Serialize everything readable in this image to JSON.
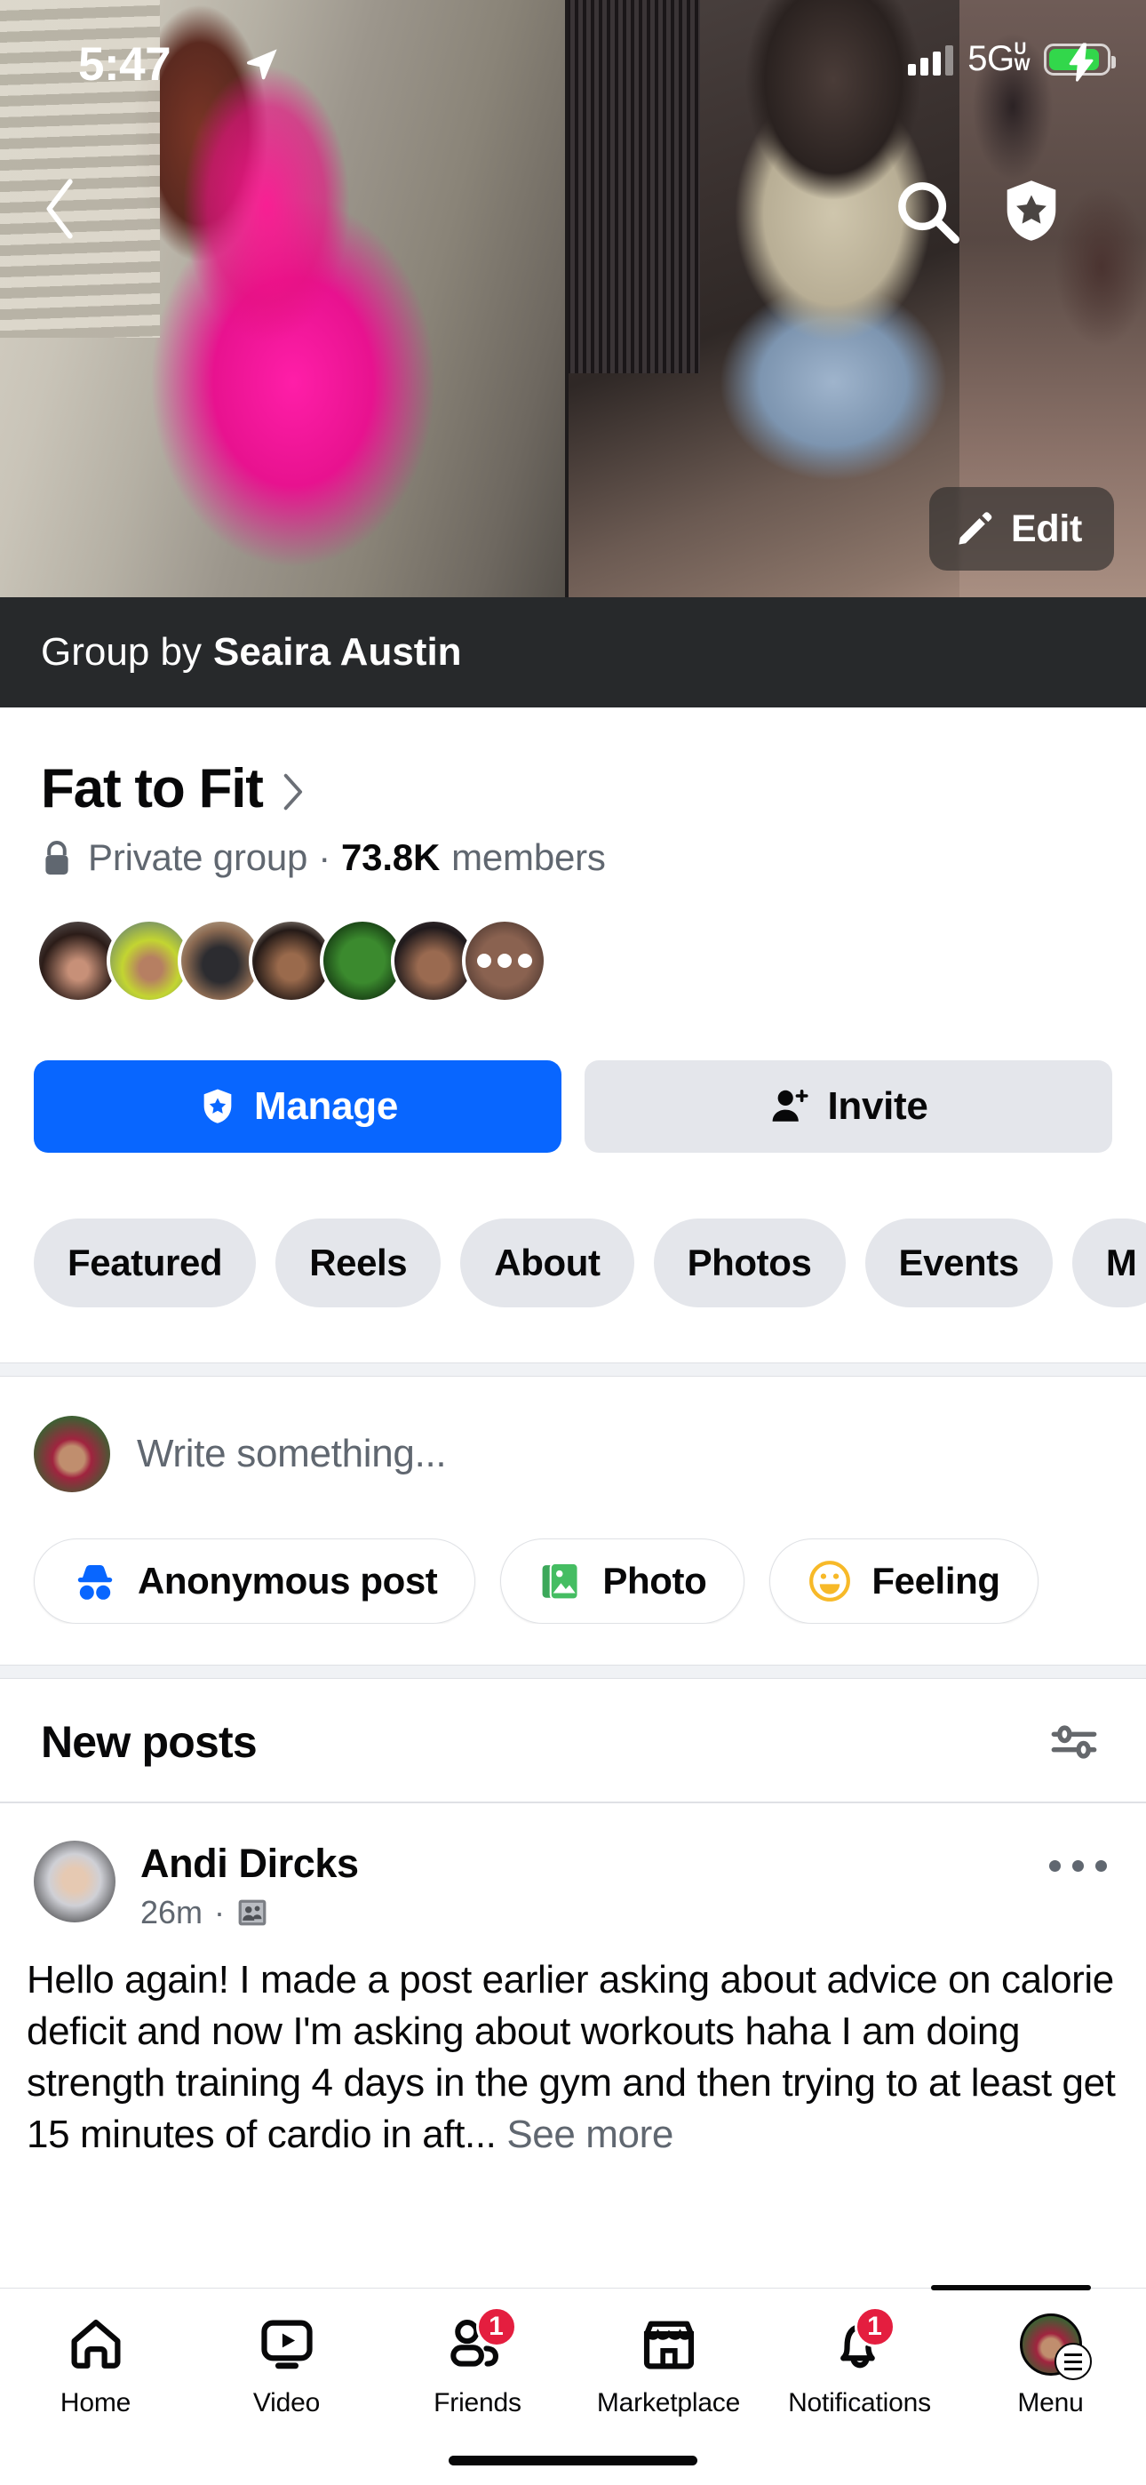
{
  "status_bar": {
    "time": "5:47",
    "location_icon": "location-arrow-icon",
    "signal_icon": "cellular-bars-icon",
    "network": "5G",
    "network_suffix_top": "U",
    "network_suffix_bottom": "W",
    "battery_icon": "battery-charging-icon",
    "battery_color": "#32d74b"
  },
  "cover": {
    "back_icon": "back-chevron-icon",
    "search_icon": "search-icon",
    "shield_icon": "shield-star-icon",
    "edit_label": "Edit",
    "edit_icon": "pencil-icon"
  },
  "group_by": {
    "prefix": "Group by",
    "owner": "Seaira Austin"
  },
  "group": {
    "name": "Fat to Fit",
    "chevron_icon": "chevron-right-icon",
    "lock_icon": "lock-icon",
    "privacy": "Private group",
    "separator": "·",
    "member_count": "73.8K",
    "member_label": "members",
    "facepile_overflow_icon": "more-dots-icon"
  },
  "actions": {
    "manage_label": "Manage",
    "manage_icon": "shield-star-icon",
    "manage_color": "#0866ff",
    "invite_label": "Invite",
    "invite_icon": "person-add-icon"
  },
  "tabs": [
    {
      "label": "Featured"
    },
    {
      "label": "Reels"
    },
    {
      "label": "About"
    },
    {
      "label": "Photos"
    },
    {
      "label": "Events"
    },
    {
      "label": "M"
    }
  ],
  "composer": {
    "avatar_name": "user-avatar",
    "placeholder": "Write something...",
    "buttons": [
      {
        "label": "Anonymous post",
        "icon": "incognito-icon",
        "color": "#0866ff"
      },
      {
        "label": "Photo",
        "icon": "photo-icon",
        "color": "#45bd62"
      },
      {
        "label": "Feeling",
        "icon": "smiley-icon",
        "color": "#f7b928"
      }
    ]
  },
  "feed": {
    "section_title": "New posts",
    "filter_icon": "sliders-icon",
    "post": {
      "author": "Andi Dircks",
      "time": "26m",
      "separator": "·",
      "audience_icon": "group-privacy-icon",
      "menu_icon": "more-dots-icon",
      "text": "Hello again! I made a post earlier asking about advice on calorie deficit and now I'm asking about workouts haha I am doing strength training 4 days in the gym and then trying to at least get 15 minutes of cardio in aft...",
      "see_more": "See more"
    }
  },
  "bottom_nav": [
    {
      "label": "Home",
      "icon": "home-icon",
      "badge": ""
    },
    {
      "label": "Video",
      "icon": "video-icon",
      "badge": ""
    },
    {
      "label": "Friends",
      "icon": "friends-icon",
      "badge": "1"
    },
    {
      "label": "Marketplace",
      "icon": "marketplace-icon",
      "badge": ""
    },
    {
      "label": "Notifications",
      "icon": "bell-icon",
      "badge": "1"
    },
    {
      "label": "Menu",
      "icon": "menu-avatar-icon",
      "badge": ""
    }
  ]
}
